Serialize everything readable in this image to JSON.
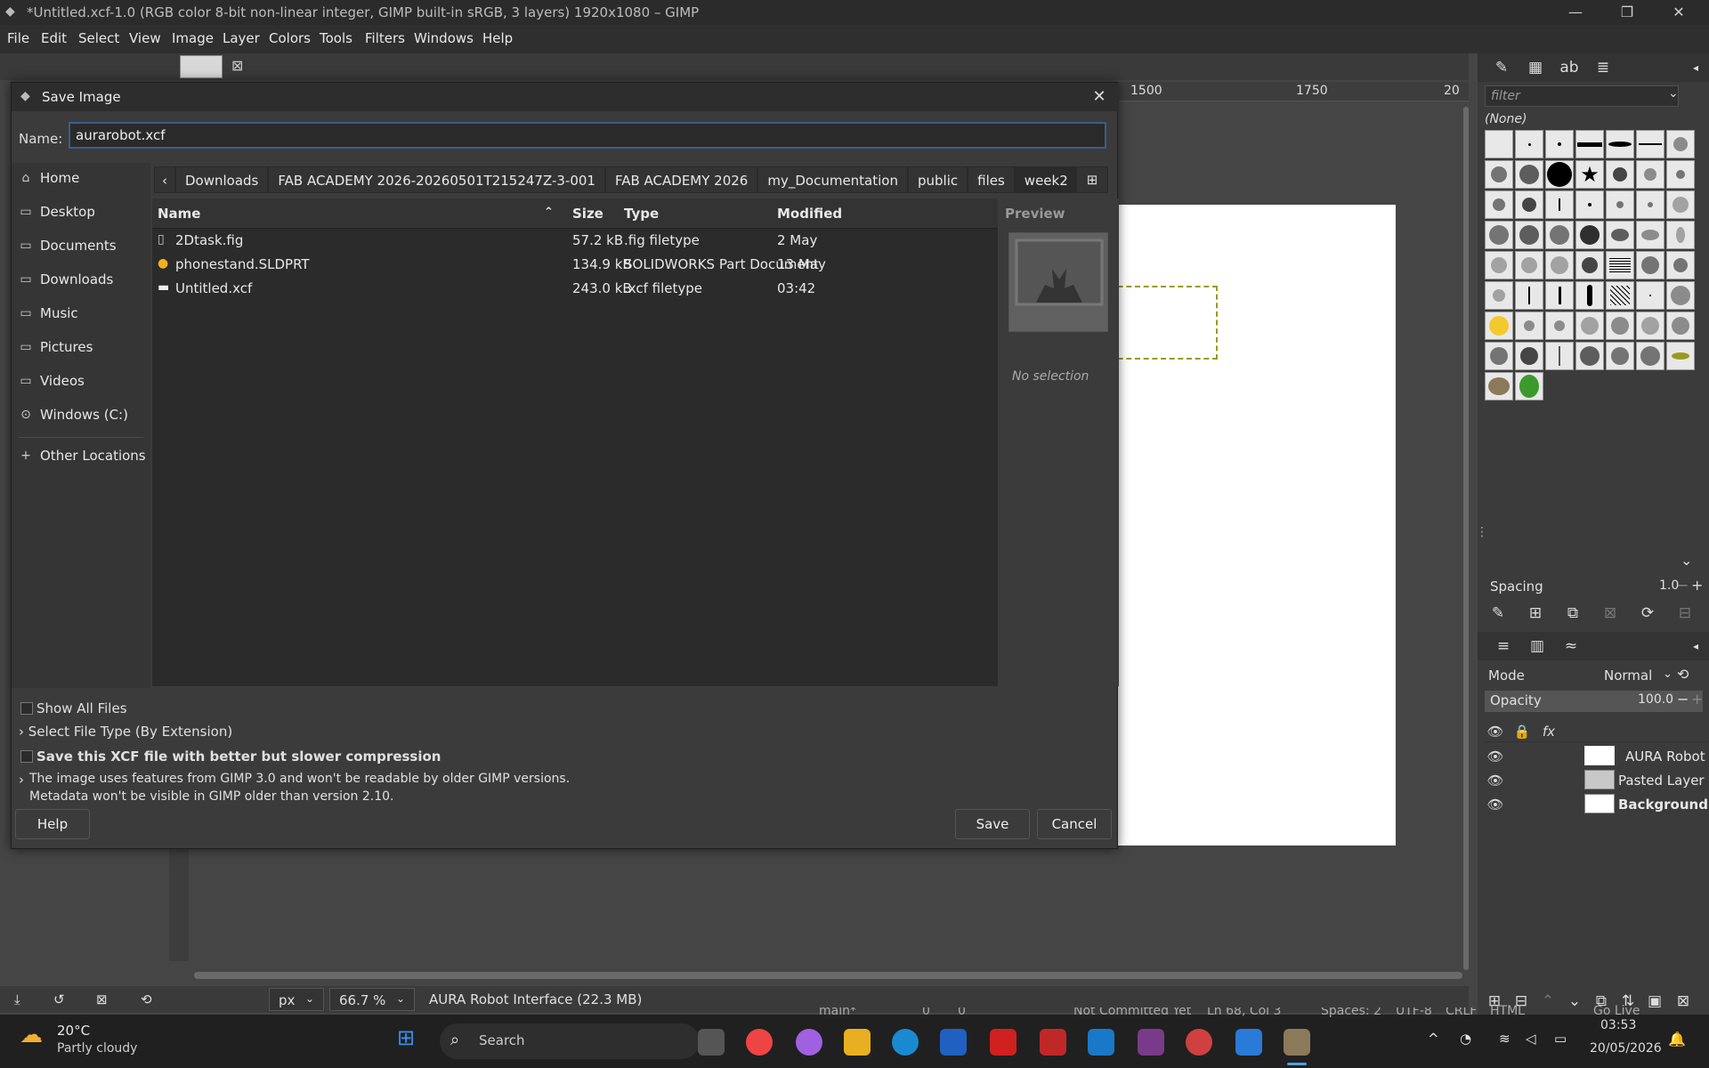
{
  "window": {
    "title": "*Untitled.xcf-1.0 (RGB color 8-bit non-linear integer, GIMP built-in sRGB, 3 layers) 1920x1080 – GIMP"
  },
  "menu": [
    "File",
    "Edit",
    "Select",
    "View",
    "Image",
    "Layer",
    "Colors",
    "Tools",
    "Filters",
    "Windows",
    "Help"
  ],
  "ruler": {
    "t1500": "1500",
    "t1750": "1750",
    "t20": "20"
  },
  "dialog": {
    "title": "Save Image",
    "name_label": "Name:",
    "name_value": "aurarobot.xcf",
    "places": [
      "Home",
      "Desktop",
      "Documents",
      "Downloads",
      "Music",
      "Pictures",
      "Videos",
      "Windows (C:)",
      "Other Locations"
    ],
    "breadcrumbs": [
      "Downloads",
      "FAB ACADEMY 2026-20260501T215247Z-3-001",
      "FAB ACADEMY 2026",
      "my_Documentation",
      "public",
      "files",
      "week2"
    ],
    "columns": {
      "name": "Name",
      "size": "Size",
      "type": "Type",
      "modified": "Modified",
      "preview": "Preview"
    },
    "files": [
      {
        "name": "2Dtask.fig",
        "size": "57.2 kB",
        "type": ".fig filetype",
        "modified": "2 May"
      },
      {
        "name": "phonestand.SLDPRT",
        "size": "134.9 kB",
        "type": "SOLIDWORKS Part Document",
        "modified": "13 May"
      },
      {
        "name": "Untitled.xcf",
        "size": "243.0 kB",
        "type": ".xcf filetype",
        "modified": "03:42"
      }
    ],
    "no_selection": "No selection",
    "show_all_files": "Show All Files",
    "select_file_type": "Select File Type (By Extension)",
    "compression": "Save this XCF file with better but slower compression",
    "compat_line1": "The image uses features from GIMP 3.0 and won't be readable by older GIMP versions.",
    "compat_line2": "Metadata won't be visible in GIMP older than version 2.10.",
    "help": "Help",
    "save": "Save",
    "cancel": "Cancel"
  },
  "dock": {
    "filter_placeholder": "filter",
    "brush_none": "(None)",
    "spacing_label": "Spacing",
    "spacing_value": "1.0",
    "mode_label": "Mode",
    "mode_value": "Normal",
    "opacity_label": "Opacity",
    "opacity_value": "100.0",
    "layers": [
      "AURA Robot",
      "Pasted Layer",
      "Background"
    ]
  },
  "status": {
    "unit": "px",
    "zoom": "66.7 %",
    "info": "AURA Robot Interface (22.3 MB)"
  },
  "vscode_status": {
    "branch": "main*",
    "problems": "0",
    "warnings": "0",
    "commit": "Not Committed Yet",
    "position": "Ln 68, Col 3",
    "spaces": "Spaces: 2",
    "encoding": "UTF-8",
    "eol": "CRLF",
    "lang": "HTML",
    "golive": "Go Live"
  },
  "taskbar": {
    "temp": "20°C",
    "weather": "Partly cloudy",
    "search": "Search",
    "time": "03:53",
    "date": "20/05/2026"
  }
}
